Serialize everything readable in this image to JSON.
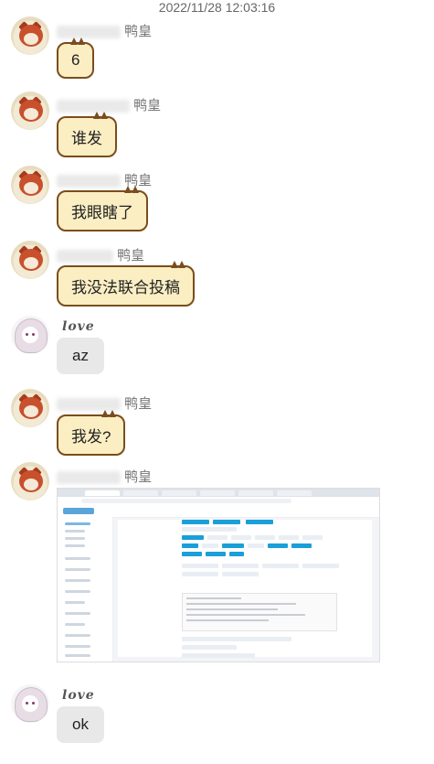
{
  "chat": {
    "timestamp": "2022/11/28 12:03:16",
    "messages": [
      {
        "sender": "鸭皇",
        "avatar": "cat-avatar",
        "style": "cat-bubble",
        "text": "6"
      },
      {
        "sender": "鸭皇",
        "avatar": "cat-avatar",
        "style": "cat-bubble",
        "text": "谁发"
      },
      {
        "sender": "鸭皇",
        "avatar": "cat-avatar",
        "style": "cat-bubble",
        "text": "我眼瞎了"
      },
      {
        "sender": "鸭皇",
        "avatar": "cat-avatar",
        "style": "cat-bubble",
        "text": "我没法联合投稿"
      },
      {
        "sender": "love",
        "avatar": "anime-girl-avatar",
        "style": "gray-bubble",
        "text": "az"
      },
      {
        "sender": "鸭皇",
        "avatar": "cat-avatar",
        "style": "cat-bubble",
        "text": "我发?"
      },
      {
        "sender": "鸭皇",
        "avatar": "cat-avatar",
        "style": "image",
        "text": ""
      },
      {
        "sender": "love",
        "avatar": "anime-girl-avatar",
        "style": "gray-bubble",
        "text": "ok"
      }
    ]
  },
  "colors": {
    "cat_bubble_bg": "#fbeec3",
    "cat_bubble_border": "#7a4d1d",
    "gray_bubble_bg": "#e8e8e8",
    "timestamp": "#666666",
    "sender_name": "#777777",
    "screenshot_accent": "#1a9fd8"
  }
}
